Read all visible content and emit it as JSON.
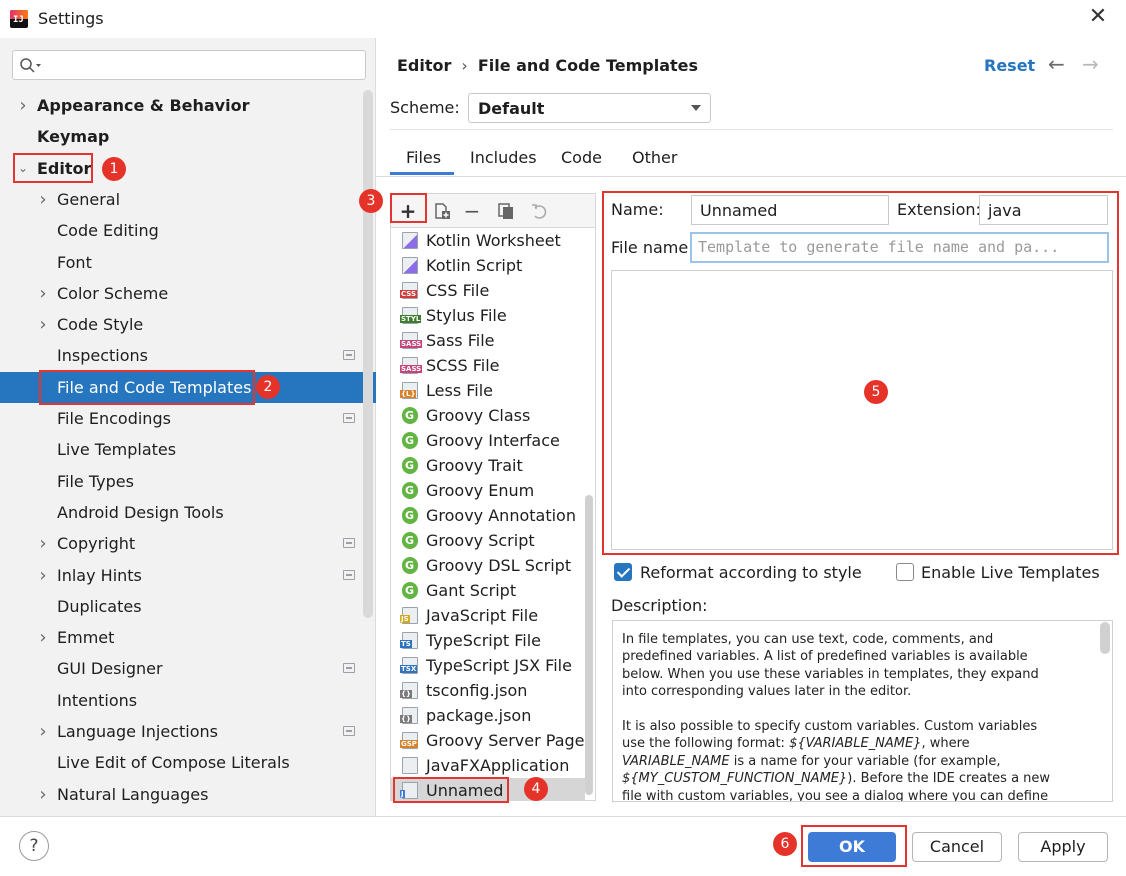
{
  "window": {
    "title": "Settings",
    "app_icon_text": "IJ"
  },
  "sidebar": {
    "search_placeholder": "",
    "items": [
      {
        "label": "Appearance & Behavior",
        "bold": true,
        "chevron": true,
        "indent": 0
      },
      {
        "label": "Keymap",
        "bold": true,
        "chevron": false,
        "indent": 0
      },
      {
        "label": "Editor",
        "bold": true,
        "chevron": "down",
        "indent": 0
      },
      {
        "label": "General",
        "chevron": true,
        "indent": 1
      },
      {
        "label": "Code Editing",
        "indent": 1
      },
      {
        "label": "Font",
        "indent": 1
      },
      {
        "label": "Color Scheme",
        "chevron": true,
        "indent": 1
      },
      {
        "label": "Code Style",
        "chevron": true,
        "indent": 1
      },
      {
        "label": "Inspections",
        "indent": 1,
        "project_icon": true
      },
      {
        "label": "File and Code Templates",
        "indent": 1,
        "selected": true
      },
      {
        "label": "File Encodings",
        "indent": 1,
        "project_icon": true
      },
      {
        "label": "Live Templates",
        "indent": 1
      },
      {
        "label": "File Types",
        "indent": 1
      },
      {
        "label": "Android Design Tools",
        "indent": 1
      },
      {
        "label": "Copyright",
        "chevron": true,
        "indent": 1,
        "project_icon": true
      },
      {
        "label": "Inlay Hints",
        "chevron": true,
        "indent": 1,
        "project_icon": true
      },
      {
        "label": "Duplicates",
        "indent": 1
      },
      {
        "label": "Emmet",
        "chevron": true,
        "indent": 1
      },
      {
        "label": "GUI Designer",
        "indent": 1,
        "project_icon": true
      },
      {
        "label": "Intentions",
        "indent": 1
      },
      {
        "label": "Language Injections",
        "chevron": true,
        "indent": 1,
        "project_icon": true
      },
      {
        "label": "Live Edit of Compose Literals",
        "indent": 1
      },
      {
        "label": "Natural Languages",
        "chevron": true,
        "indent": 1
      }
    ]
  },
  "header": {
    "breadcrumb": [
      "Editor",
      "File and Code Templates"
    ],
    "breadcrumb_sep": "›",
    "reset_label": "Reset",
    "back_icon": "←",
    "forward_icon": "→"
  },
  "scheme": {
    "label": "Scheme:",
    "value": "Default"
  },
  "tabs": [
    "Files",
    "Includes",
    "Code",
    "Other"
  ],
  "templates": [
    {
      "label": "Kotlin Worksheet",
      "icon": "kotlin"
    },
    {
      "label": "Kotlin Script",
      "icon": "kotlin"
    },
    {
      "label": "CSS File",
      "icon": "file",
      "tag": "CSS",
      "tag_color": "#d03a3a"
    },
    {
      "label": "Stylus File",
      "icon": "file",
      "tag": "STYL",
      "tag_color": "#3f7d2e"
    },
    {
      "label": "Sass File",
      "icon": "file",
      "tag": "SASS",
      "tag_color": "#c5457b"
    },
    {
      "label": "SCSS File",
      "icon": "file",
      "tag": "SASS",
      "tag_color": "#c5457b"
    },
    {
      "label": "Less File",
      "icon": "file",
      "tag": "{L}",
      "tag_color": "#d9822b"
    },
    {
      "label": "Groovy Class",
      "icon": "groovy"
    },
    {
      "label": "Groovy Interface",
      "icon": "groovy"
    },
    {
      "label": "Groovy Trait",
      "icon": "groovy"
    },
    {
      "label": "Groovy Enum",
      "icon": "groovy"
    },
    {
      "label": "Groovy Annotation",
      "icon": "groovy"
    },
    {
      "label": "Groovy Script",
      "icon": "groovy"
    },
    {
      "label": "Groovy DSL Script",
      "icon": "groovy"
    },
    {
      "label": "Gant Script",
      "icon": "groovy"
    },
    {
      "label": "JavaScript File",
      "icon": "file",
      "tag": "JS",
      "tag_color": "#d4a81c"
    },
    {
      "label": "TypeScript File",
      "icon": "file",
      "tag": "TS",
      "tag_color": "#2f74c0"
    },
    {
      "label": "TypeScript JSX File",
      "icon": "file",
      "tag": "TSX",
      "tag_color": "#2f74c0"
    },
    {
      "label": "tsconfig.json",
      "icon": "file",
      "tag": "{}",
      "tag_color": "#7a7a7a"
    },
    {
      "label": "package.json",
      "icon": "file",
      "tag": "{}",
      "tag_color": "#7a7a7a"
    },
    {
      "label": "Groovy Server Page",
      "icon": "file",
      "tag": "GSP",
      "tag_color": "#d9822b"
    },
    {
      "label": "JavaFXApplication",
      "icon": "file",
      "tag": "",
      "tag_color": "#7a7a7a"
    },
    {
      "label": "Unnamed",
      "icon": "file",
      "tag": "J",
      "tag_color": "#3d7bd6",
      "selected": true
    }
  ],
  "list_toolbar": {
    "add": "+",
    "remove": "−"
  },
  "form": {
    "name_label": "Name:",
    "name_value": "Unnamed",
    "extension_label": "Extension:",
    "extension_value": "java",
    "filename_label": "File name:",
    "filename_placeholder": "Template to generate file name and pa...",
    "reformat_label": "Reformat according to style",
    "reformat_checked": true,
    "live_templates_label": "Enable Live Templates",
    "live_templates_checked": false,
    "description_label": "Description:"
  },
  "description": {
    "p1": "In file templates, you can use text, code, comments, and predefined variables. A list of predefined variables is available below. When you use these variables in templates, they expand into corresponding values later in the editor.",
    "p2_pre": "It is also possible to specify custom variables. Custom variables use the following format: ",
    "p2_var1": "${VARIABLE_NAME}",
    "p2_mid1": ", where ",
    "p2_var2": "VARIABLE_NAME",
    "p2_mid2": " is a name for your variable (for example, ",
    "p2_var3": "${MY_CUSTOM_FUNCTION_NAME}",
    "p2_post": "). Before the IDE creates a new file with custom variables, you see a dialog where you can define values for custom variables in the template."
  },
  "buttons": {
    "help": "?",
    "ok": "OK",
    "cancel": "Cancel",
    "apply": "Apply"
  },
  "annotations": [
    "1",
    "2",
    "3",
    "4",
    "5",
    "6"
  ],
  "colors": {
    "accent": "#2675bf",
    "annotation": "#e3352e",
    "ok_button": "#3d7bd6"
  }
}
